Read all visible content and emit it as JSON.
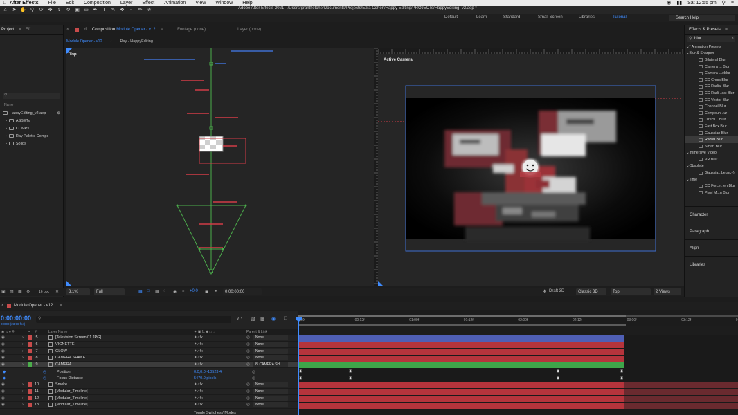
{
  "menubar": {
    "app": "After Effects",
    "items": [
      "File",
      "Edit",
      "Composition",
      "Layer",
      "Effect",
      "Animation",
      "View",
      "Window",
      "Help"
    ],
    "clock": "Sat 12:55 pm"
  },
  "window_title": "Adobe After Effects 2021 - /Users/grantfletcherDocuments/Projects/Ezra Cohen/Happy Editing/PROJECTs/HappyEditing_v2.aep *",
  "workspaces": [
    "Default",
    "Learn",
    "Standard",
    "Small Screen",
    "Libraries",
    "Tutorial"
  ],
  "active_workspace": "Tutorial",
  "search_help": "Search Help",
  "project": {
    "tab": "Project",
    "tab2": "Eff",
    "column_name": "Name",
    "items": [
      {
        "name": "HappyEditing_v2.aep",
        "type": "project"
      },
      {
        "name": "ASSETs",
        "type": "folder"
      },
      {
        "name": "COMPs",
        "type": "folder"
      },
      {
        "name": "Ray Palette Comps",
        "type": "folder"
      },
      {
        "name": "Solids",
        "type": "folder"
      }
    ],
    "bpc": "16 bpc"
  },
  "composition": {
    "tab_prefix": "Composition",
    "tab_name": "Module Opener - v12",
    "footage": "Footage (none)",
    "layer": "Layer (none)",
    "sub_tabs": [
      "Module Opener - v12",
      "Ray - HappyEditing"
    ],
    "left_view_label": "Top",
    "right_view_label": "Active Camera"
  },
  "viewer_footer": {
    "zoom": "3.1%",
    "resolution": "Full",
    "exposure": "+0.0",
    "timecode": "0:00:00:00",
    "renderer_mode": "Draft 3D",
    "renderer": "Classic 3D",
    "view": "Top",
    "views": "2 Views"
  },
  "effects": {
    "title": "Effects & Presets",
    "search_value": "blur",
    "tree": [
      {
        "label": "* Animation Presets",
        "kind": "cat"
      },
      {
        "label": "Blur & Sharpen",
        "kind": "cat"
      },
      {
        "label": "Bilateral Blur",
        "kind": "item"
      },
      {
        "label": "Camera ... Blur",
        "kind": "item"
      },
      {
        "label": "Camera-...eblur",
        "kind": "item"
      },
      {
        "label": "CC Cross Blur",
        "kind": "item"
      },
      {
        "label": "CC Radial Blur",
        "kind": "item"
      },
      {
        "label": "CC Radi...ast Blur",
        "kind": "item"
      },
      {
        "label": "CC Vector Blur",
        "kind": "item"
      },
      {
        "label": "Channel Blur",
        "kind": "item"
      },
      {
        "label": "Compoun...ur",
        "kind": "item"
      },
      {
        "label": "Directi... Blur",
        "kind": "item"
      },
      {
        "label": "Fast Box Blur",
        "kind": "item"
      },
      {
        "label": "Gaussian Blur",
        "kind": "item"
      },
      {
        "label": "Radial Blur",
        "kind": "item",
        "selected": true
      },
      {
        "label": "Smart Blur",
        "kind": "item"
      },
      {
        "label": "Immersive Video",
        "kind": "cat"
      },
      {
        "label": "VR Blur",
        "kind": "item"
      },
      {
        "label": "Obsolete",
        "kind": "cat"
      },
      {
        "label": "Gaussia...Legacy)",
        "kind": "item"
      },
      {
        "label": "Time",
        "kind": "cat"
      },
      {
        "label": "CC Force...en Blur",
        "kind": "item"
      },
      {
        "label": "Pixel M...n Blur",
        "kind": "item"
      }
    ],
    "side_panels": [
      "Character",
      "Paragraph",
      "Align",
      "Libraries"
    ]
  },
  "timeline": {
    "comp_name": "Module Opener - v12",
    "timecode": "0:00:00:00",
    "fps_info": "00000 (23.98 fps)",
    "col_layer_name": "Layer Name",
    "col_parent": "Parent & Link",
    "ruler_ticks": [
      "00f",
      "00:12f",
      "01:00f",
      "01:12f",
      "02:00f",
      "02:12f",
      "03:00f",
      "03:12f",
      "04:0"
    ],
    "layers": [
      {
        "num": "5",
        "name": "[Television Screen 01.JPG]",
        "color": "#c84b4b",
        "parent": "None"
      },
      {
        "num": "6",
        "name": "VIGNETTE",
        "color": "#c84b4b",
        "parent": "None"
      },
      {
        "num": "7",
        "name": "GLOW",
        "color": "#c84b4b",
        "parent": "None"
      },
      {
        "num": "8",
        "name": "CAMERA SHAKE",
        "color": "#c84b4b",
        "parent": "None"
      },
      {
        "num": "9",
        "name": "CAMERA",
        "color": "#4cae4c",
        "parent": "8. CAMERA SH",
        "selected": true
      },
      {
        "num": "10",
        "name": "Smoke",
        "color": "#c84b4b",
        "parent": "None"
      },
      {
        "num": "11",
        "name": "[Modular_Timeline]",
        "color": "#c84b4b",
        "parent": "None"
      },
      {
        "num": "12",
        "name": "[Modular_Timeline]",
        "color": "#c84b4b",
        "parent": "None"
      },
      {
        "num": "13",
        "name": "[Modular_Timeline]",
        "color": "#c84b4b",
        "parent": "None"
      }
    ],
    "properties": [
      {
        "name": "Position",
        "value": "0.0,0.0,-10523.4"
      },
      {
        "name": "Focus Distance",
        "value": "5470.0 pixels"
      }
    ],
    "toggle_label": "Toggle Switches / Modes"
  },
  "colors": {
    "accent": "#3f8cff",
    "layer_red": "#b5343c",
    "layer_green": "#3ea54a",
    "layer_blue": "#4f5fb5"
  }
}
